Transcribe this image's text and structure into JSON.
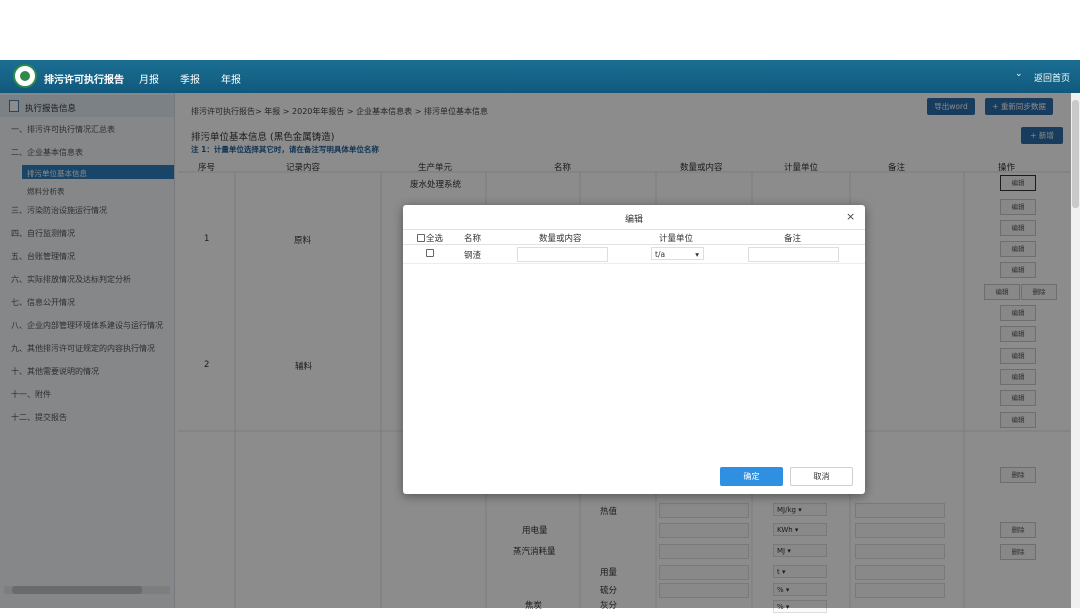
{
  "header": {
    "app_title": "排污许可执行报告",
    "nav": [
      "月报",
      "季报",
      "年报"
    ],
    "home_link": "返回首页",
    "chevron": "⌄"
  },
  "sidebar": {
    "heading": "执行报告信息",
    "items": [
      "一、排污许可执行情况汇总表",
      "二、企业基本信息表",
      "三、污染防治设施运行情况",
      "四、自行监测情况",
      "五、台账管理情况",
      "六、实际排放情况及达标判定分析",
      "七、信息公开情况",
      "八、企业内部管理环境体系建设与运行情况",
      "九、其他排污许可证规定的内容执行情况",
      "十、其他需要说明的情况",
      "十一、附件",
      "十二、提交报告"
    ],
    "sub_items": [
      "排污单位基本信息",
      "燃料分析表"
    ]
  },
  "main": {
    "breadcrumb": "排污许可执行报告> 年报 > 2020年年报告 > 企业基本信息表 > 排污单位基本信息",
    "export_button": "导出word",
    "sync_button": "+ 重新同步数据",
    "add_button": "+ 新增",
    "title": "排污单位基本信息 (黑色金属铸造)",
    "note": "注 1：计量单位选择其它时，请在备注写明具体单位名称",
    "columns": [
      "序号",
      "记录内容",
      "生产单元",
      "名称",
      "数量或内容",
      "计量单位",
      "备注",
      "操作"
    ],
    "rows": [
      {
        "index": "1",
        "content": "原料",
        "unit": "废水处理系统"
      },
      {
        "index": "2",
        "content": "辅料"
      }
    ],
    "lower_rows": [
      {
        "name": "",
        "sub": "热值",
        "unit": "MJ/kg"
      },
      {
        "name": "用电量",
        "sub": "",
        "unit": "KWh"
      },
      {
        "name": "蒸汽消耗量",
        "sub": "",
        "unit": "MJ"
      },
      {
        "name": "",
        "sub": "用量",
        "unit": "t"
      },
      {
        "name": "",
        "sub": "硫分",
        "unit": "%"
      },
      {
        "name": "焦炭",
        "sub": "灰分",
        "unit": "%"
      }
    ],
    "edit_label": "编辑",
    "delete_label": "删除"
  },
  "modal": {
    "title": "编辑",
    "close": "×",
    "columns": [
      "全选",
      "名称",
      "数量或内容",
      "计量单位",
      "备注"
    ],
    "row": {
      "name": "钢渣",
      "quantity": "",
      "unit": "t/a",
      "remark": ""
    },
    "confirm": "确定",
    "cancel": "取消"
  }
}
